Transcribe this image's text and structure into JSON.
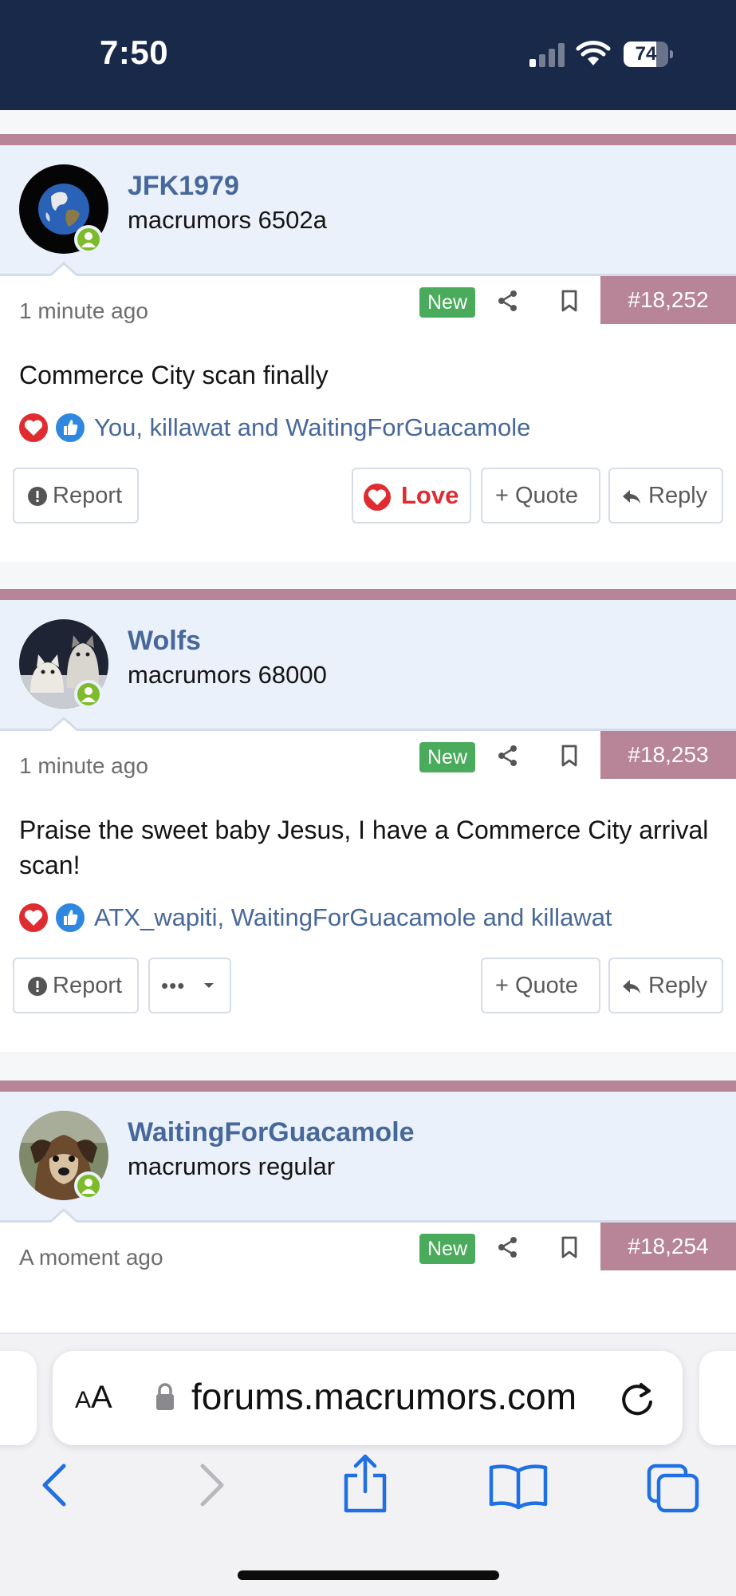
{
  "status_bar": {
    "time": "7:50",
    "battery_level": "74",
    "battery_fraction": 0.74
  },
  "posts": [
    {
      "username": "JFK1979",
      "user_title": "macrumors 6502a",
      "avatar": "earth-globe",
      "time": "1 minute ago",
      "new_badge": "New",
      "post_number": "#18,252",
      "body": "Commerce City scan finally",
      "reactions": "You, killawat and WaitingForGuacamole",
      "buttons": {
        "report": "Report",
        "love": "Love",
        "quote": "+ Quote",
        "reply": "Reply"
      }
    },
    {
      "username": "Wolfs",
      "user_title": "macrumors 68000",
      "avatar": "husky-dogs",
      "time": "1 minute ago",
      "new_badge": "New",
      "post_number": "#18,253",
      "body": "Praise the sweet baby Jesus, I have a Commerce City arrival scan!",
      "reactions": "ATX_wapiti, WaitingForGuacamole and killawat",
      "buttons": {
        "report": "Report",
        "more": "•••",
        "quote": "+ Quote",
        "reply": "Reply"
      }
    },
    {
      "username": "WaitingForGuacamole",
      "user_title": "macrumors regular",
      "avatar": "small-dog",
      "time": "A moment ago",
      "new_badge": "New",
      "post_number": "#18,254"
    }
  ],
  "browser": {
    "text_size_label_big": "A",
    "text_size_label_small": "A",
    "url": "forums.macrumors.com",
    "nav_icons": [
      "back-icon",
      "forward-icon",
      "share-icon",
      "bookmarks-icon",
      "tabs-icon"
    ]
  }
}
